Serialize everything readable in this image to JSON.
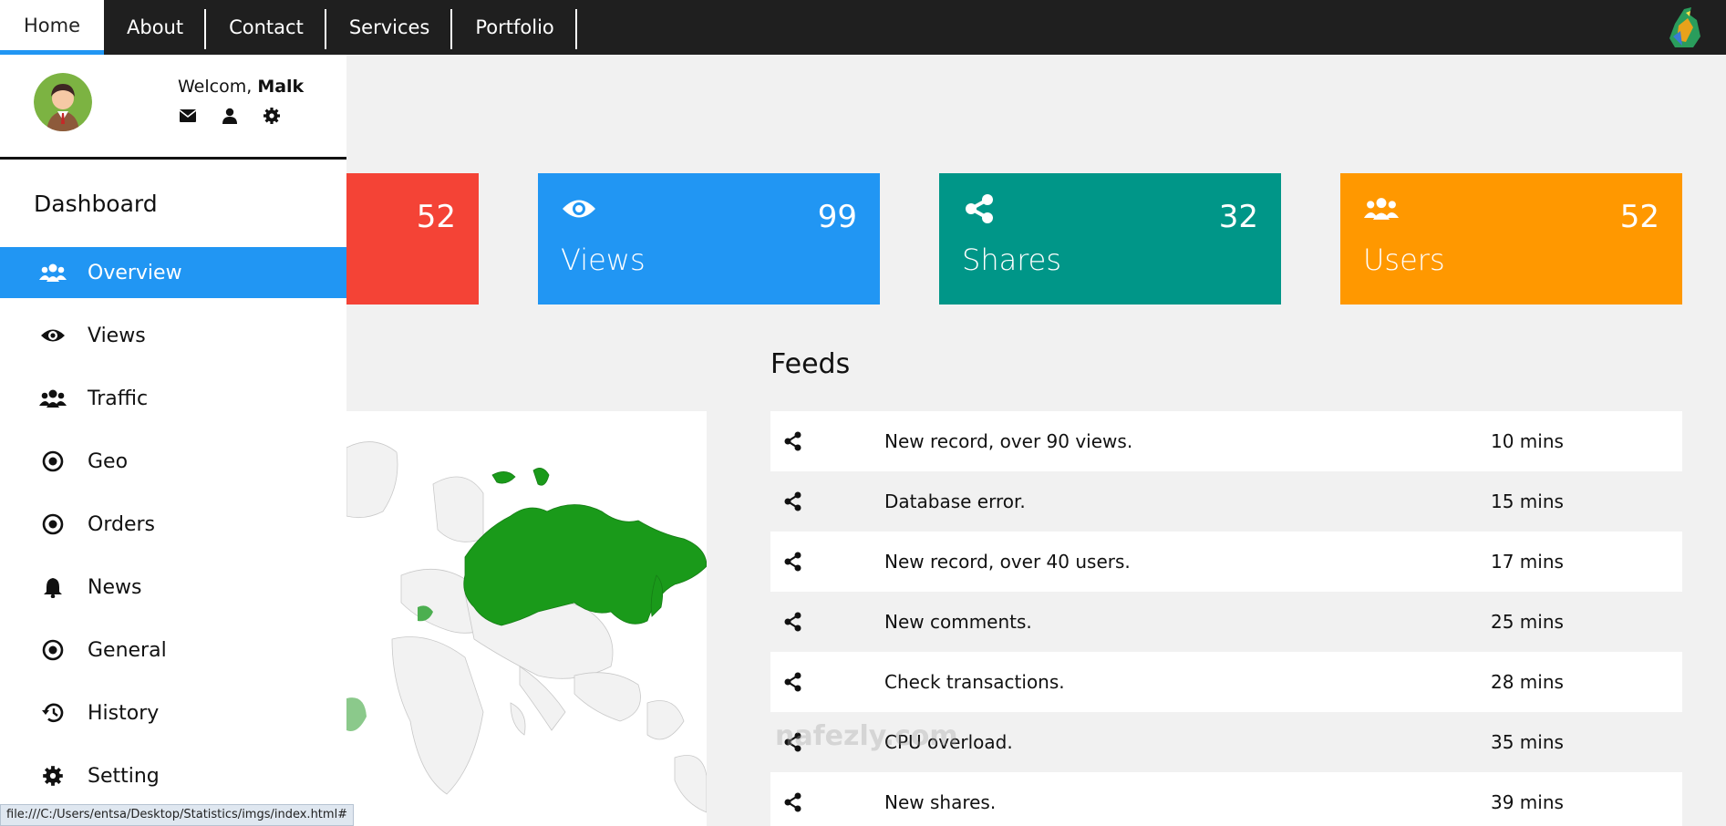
{
  "nav": {
    "items": [
      {
        "label": "Home"
      },
      {
        "label": "About"
      },
      {
        "label": "Contact"
      },
      {
        "label": "Services"
      },
      {
        "label": "Portfolio"
      }
    ]
  },
  "profile": {
    "welcome_prefix": "Welcom, ",
    "user_name": "Malk",
    "icons": [
      "envelope-icon",
      "user-icon",
      "gear-icon"
    ]
  },
  "sidebar": {
    "title": "Dashboard",
    "items": [
      {
        "label": "Overview",
        "icon": "users-icon",
        "active": true
      },
      {
        "label": "Views",
        "icon": "eye-icon"
      },
      {
        "label": "Traffic",
        "icon": "users-icon"
      },
      {
        "label": "Geo",
        "icon": "dot-circle-icon"
      },
      {
        "label": "Orders",
        "icon": "dot-circle-icon"
      },
      {
        "label": "News",
        "icon": "bell-icon"
      },
      {
        "label": "General",
        "icon": "dot-circle-icon"
      },
      {
        "label": "History",
        "icon": "history-icon"
      },
      {
        "label": "Setting",
        "icon": "gear-icon"
      }
    ]
  },
  "cards": [
    {
      "value": "52",
      "label": "",
      "color": "#f44336",
      "icon": "comment-icon"
    },
    {
      "value": "99",
      "label": "Views",
      "color": "#2196f3",
      "icon": "eye-icon"
    },
    {
      "value": "32",
      "label": "Shares",
      "color": "#009688",
      "icon": "share-icon"
    },
    {
      "value": "52",
      "label": "Users",
      "color": "#ff9800",
      "icon": "users-icon"
    }
  ],
  "feeds": {
    "title": "Feeds",
    "rows": [
      {
        "text": "New record, over 90 views.",
        "time": "10 mins"
      },
      {
        "text": "Database error.",
        "time": "15 mins"
      },
      {
        "text": "New record, over 40 users.",
        "time": "17 mins"
      },
      {
        "text": "New comments.",
        "time": "25 mins"
      },
      {
        "text": "Check transactions.",
        "time": "28 mins"
      },
      {
        "text": "CPU overload.",
        "time": "35 mins"
      },
      {
        "text": "New shares.",
        "time": "39 mins"
      }
    ]
  },
  "status_bar": "file:///C:/Users/entsa/Desktop/Statistics/imgs/index.html#",
  "watermark": "nafezly.com",
  "colors": {
    "accent": "#2196f3",
    "topbar": "#1f1f1f",
    "map_green": "#1a9a1a"
  }
}
